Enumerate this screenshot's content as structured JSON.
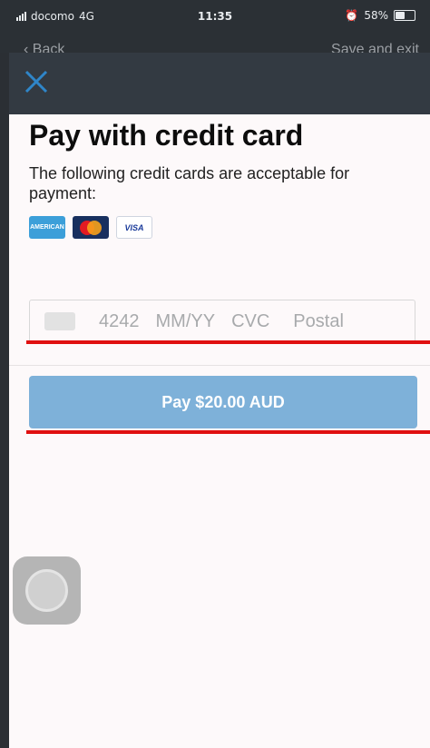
{
  "status_bar": {
    "carrier": "docomo",
    "network": "4G",
    "time": "11:35",
    "battery": "58%",
    "battery_level": 0.58
  },
  "behind_nav": {
    "back_label": "Back",
    "save_label": "Save and exit"
  },
  "header": {
    "close_icon": "close-icon",
    "close_color": "#2f86c9"
  },
  "payment": {
    "title": "Pay with credit card",
    "subtitle": "The following credit cards are acceptable for payment:",
    "cards": [
      {
        "name": "amex",
        "label": "AMERICAN"
      },
      {
        "name": "mastercard",
        "label": ""
      },
      {
        "name": "visa",
        "label": "VISA"
      }
    ],
    "card_field": {
      "number_placeholder": "4242",
      "expiry_placeholder": "MM/YY",
      "cvc_placeholder": "CVC",
      "postal_placeholder": "Postal"
    },
    "pay_button": "Pay $20.00 AUD"
  },
  "colors": {
    "pay_button": "#7eb1d9",
    "highlight": "#e01010",
    "header": "#333a42"
  }
}
